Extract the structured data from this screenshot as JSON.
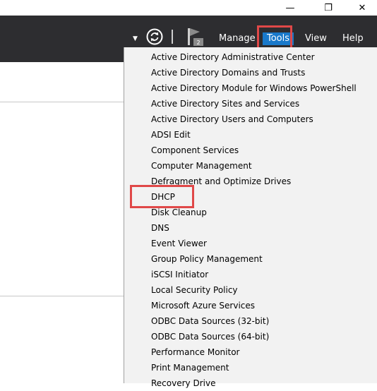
{
  "window": {
    "controls": {
      "minimize": "—",
      "restore": "❐",
      "close": "✕"
    }
  },
  "toolbar": {
    "dropdown_icon": "chevron-down-icon",
    "refresh_icon": "refresh-icon",
    "flag_icon": "notifications-flag-icon",
    "notification_count": "2",
    "menus": {
      "manage": "Manage",
      "tools": "Tools",
      "view": "View",
      "help": "Help"
    },
    "active_menu": "Tools",
    "colors": {
      "bar": "#2d2d30",
      "active_menu": "#1979ca",
      "highlight": "#e04848"
    }
  },
  "tools_menu": {
    "items": [
      "Active Directory Administrative Center",
      "Active Directory Domains and Trusts",
      "Active Directory Module for Windows PowerShell",
      "Active Directory Sites and Services",
      "Active Directory Users and Computers",
      "ADSI Edit",
      "Component Services",
      "Computer Management",
      "Defragment and Optimize Drives",
      "DHCP",
      "Disk Cleanup",
      "DNS",
      "Event Viewer",
      "Group Policy Management",
      "iSCSI Initiator",
      "Local Security Policy",
      "Microsoft Azure Services",
      "ODBC Data Sources (32-bit)",
      "ODBC Data Sources (64-bit)",
      "Performance Monitor",
      "Print Management",
      "Recovery Drive"
    ],
    "highlighted_item": "DHCP"
  }
}
